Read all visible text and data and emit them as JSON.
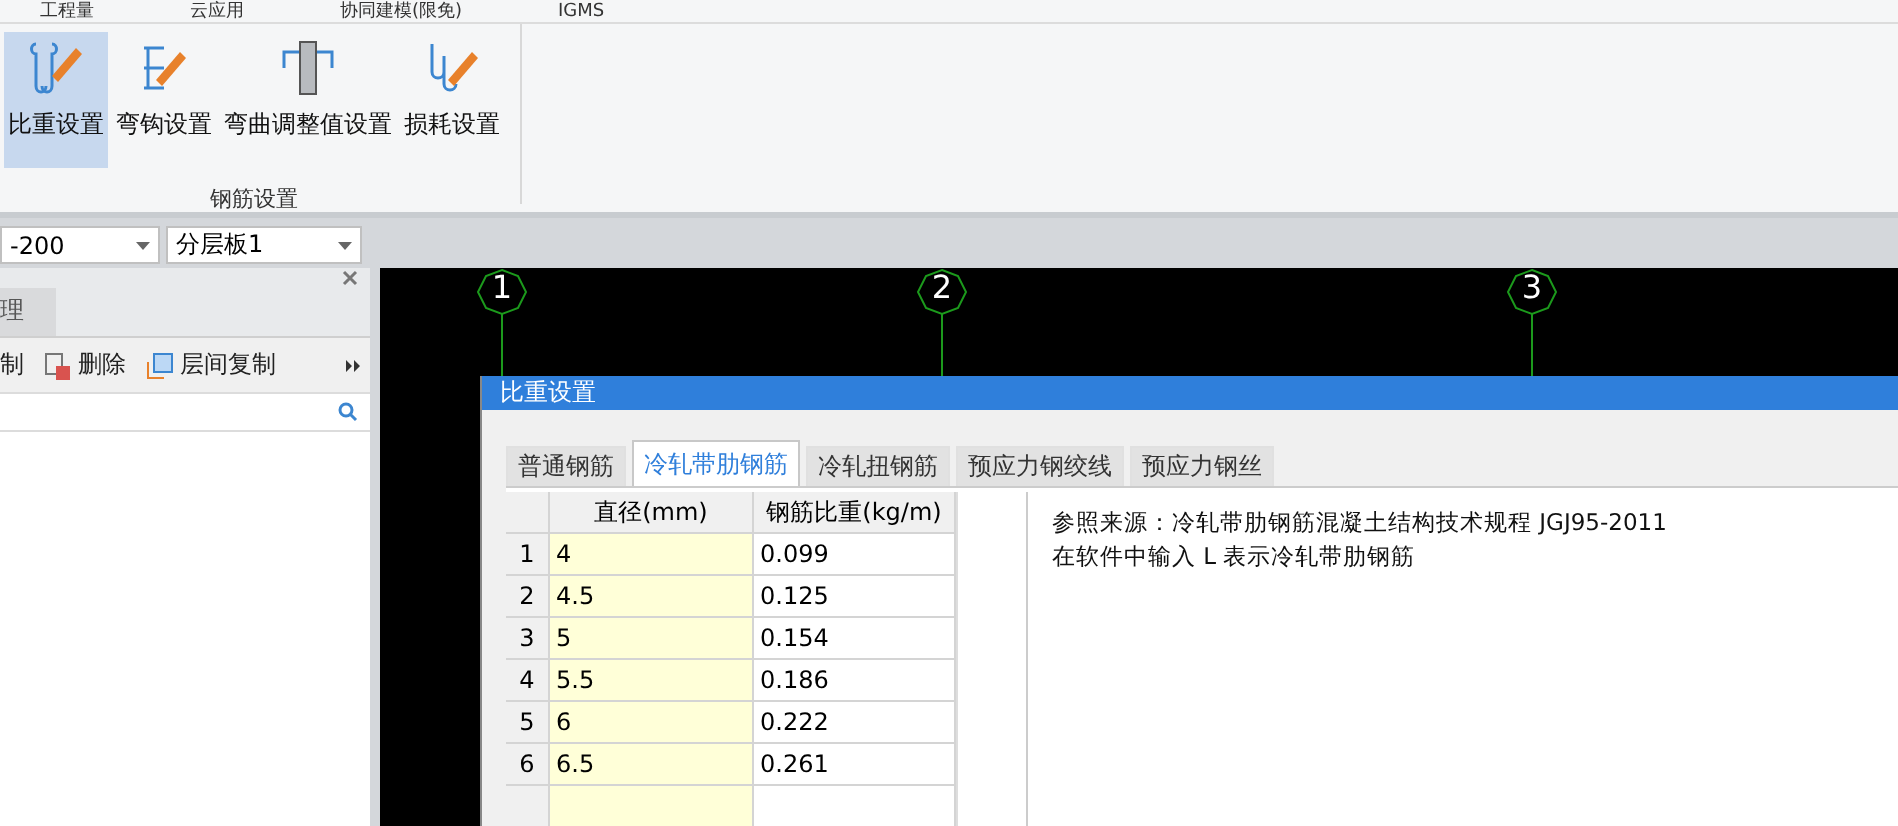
{
  "menu": [
    "工程量",
    "云应用",
    "协同建模(限免)",
    "IGMS"
  ],
  "ribbon": {
    "group_label": "钢筋设置",
    "buttons": [
      {
        "label": "比重设置",
        "selected": true
      },
      {
        "label": "弯钩设置",
        "selected": false
      },
      {
        "label": "弯曲调整值设置",
        "selected": false
      },
      {
        "label": "损耗设置",
        "selected": false
      }
    ]
  },
  "selectors": [
    "-200",
    "分层板1"
  ],
  "left_panel": {
    "tab": "理",
    "tools": [
      "制",
      "删除",
      "层间复制"
    ]
  },
  "axes": [
    "1",
    "2",
    "3"
  ],
  "dialog": {
    "title": "比重设置",
    "tabs": [
      {
        "label": "普通钢筋",
        "selected": false
      },
      {
        "label": "冷轧带肋钢筋",
        "selected": true
      },
      {
        "label": "冷轧扭钢筋",
        "selected": false
      },
      {
        "label": "预应力钢绞线",
        "selected": false
      },
      {
        "label": "预应力钢丝",
        "selected": false
      }
    ],
    "table": {
      "columns": [
        "",
        "直径(mm)",
        "钢筋比重(kg/m)"
      ],
      "rows": [
        [
          "1",
          "4",
          "0.099"
        ],
        [
          "2",
          "4.5",
          "0.125"
        ],
        [
          "3",
          "5",
          "0.154"
        ],
        [
          "4",
          "5.5",
          "0.186"
        ],
        [
          "5",
          "6",
          "0.222"
        ],
        [
          "6",
          "6.5",
          "0.261"
        ]
      ]
    },
    "notes": [
      "参照来源：冷轧带肋钢筋混凝土结构技术规程 JGJ95-2011",
      "在软件中输入 L 表示冷轧带肋钢筋"
    ]
  }
}
